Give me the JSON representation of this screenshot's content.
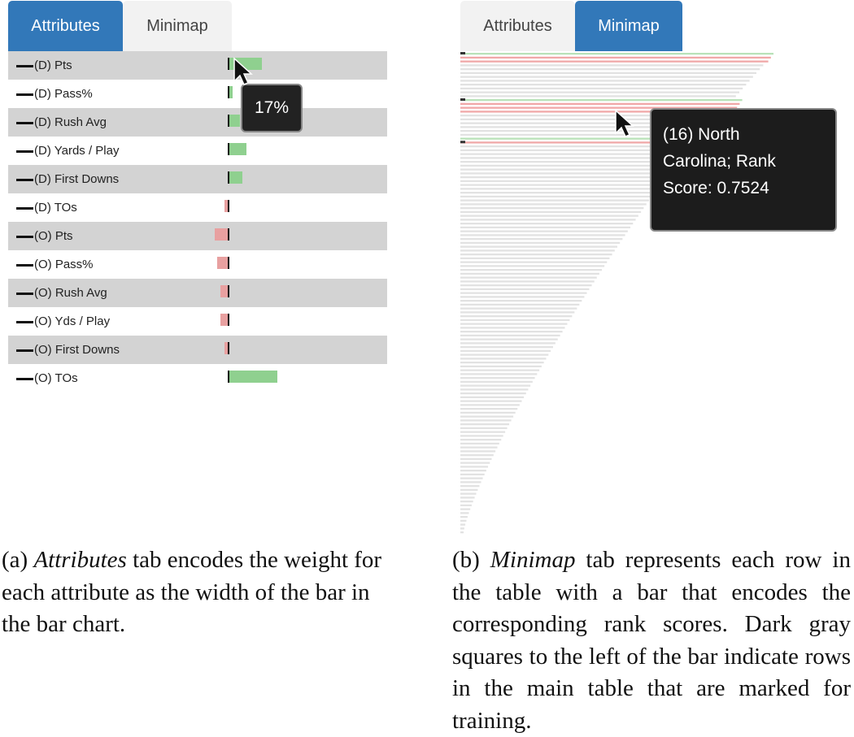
{
  "panel_a": {
    "tabs": [
      {
        "label": "Attributes",
        "active": true
      },
      {
        "label": "Minimap",
        "active": false
      }
    ],
    "attributes": [
      {
        "label": "(D) Pts",
        "weight": 0.17
      },
      {
        "label": "(D) Pass%",
        "weight": 0.02
      },
      {
        "label": "(D) Rush Avg",
        "weight": 0.06
      },
      {
        "label": "(D) Yards / Play",
        "weight": 0.09
      },
      {
        "label": "(D) First Downs",
        "weight": 0.07
      },
      {
        "label": "(D) TOs",
        "weight": -0.02
      },
      {
        "label": "(O) Pts",
        "weight": -0.07
      },
      {
        "label": "(O) Pass%",
        "weight": -0.06
      },
      {
        "label": "(O) Rush Avg",
        "weight": -0.04
      },
      {
        "label": "(O) Yds / Play",
        "weight": -0.04
      },
      {
        "label": "(O) First Downs",
        "weight": -0.02
      },
      {
        "label": "(O) TOs",
        "weight": 0.25
      }
    ],
    "tooltip": "17%",
    "caption": {
      "prefix": "(a) ",
      "emph": "Attributes",
      "text": " tab encodes the weight for each attribute as the width of the bar in the bar chart."
    }
  },
  "panel_b": {
    "tabs": [
      {
        "label": "Attributes",
        "active": false
      },
      {
        "label": "Minimap",
        "active": true
      }
    ],
    "tooltip_lines": [
      "(16) North",
      "Carolina; Rank",
      "Score: 0.7524"
    ],
    "caption": {
      "prefix": "(b) ",
      "emph": "Minimap",
      "text": " tab represents each row in the table with a bar that encodes the corresponding rank scores. Dark gray squares to the left of the bar indicate rows in the main table that are marked for training."
    }
  },
  "colors": {
    "tab_active": "#3278b9",
    "positive_bar": "#8fd08f",
    "negative_bar": "#e8a0a0",
    "minimap_bar": "#e2e2e2",
    "minimap_green": "#b9e2b9",
    "minimap_red": "#f0a8a8",
    "training_marker": "#333333"
  },
  "icons": [
    "cursor-arrow-icon"
  ]
}
